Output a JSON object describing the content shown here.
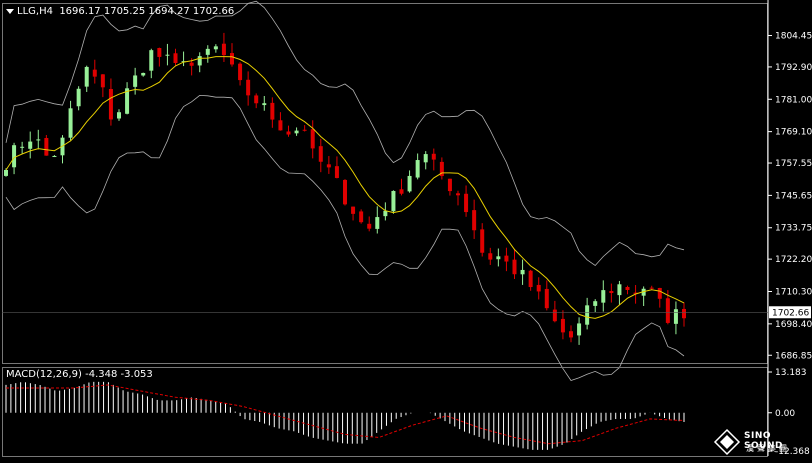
{
  "header": {
    "symbol": "LLG,H4",
    "ohlc": "1696.17 1705.25 1694.27 1702.66"
  },
  "macd_panel": {
    "label": "MACD(12,26,9) -4.348 -3.053",
    "ticks": [
      "13.183",
      "0.00",
      "-12.368"
    ],
    "tick_values": [
      13.183,
      0.0,
      -12.368
    ]
  },
  "price_axis": {
    "ticks": [
      "1804.45",
      "1792.90",
      "1781.00",
      "1769.10",
      "1757.55",
      "1745.65",
      "1733.75",
      "1722.20",
      "1710.30",
      "1698.40",
      "1686.85"
    ],
    "tick_values": [
      1804.45,
      1792.9,
      1781.0,
      1769.1,
      1757.55,
      1745.65,
      1733.75,
      1722.2,
      1710.3,
      1698.4,
      1686.85
    ],
    "current_price": "1702.66"
  },
  "logo": {
    "text": "SINO SOUND",
    "chinese": "漢聲集團"
  },
  "colors": {
    "background": "#000000",
    "bull": "#98f098",
    "bear": "#e00000",
    "ma": "#e8d000",
    "bands": "#b0b0b0",
    "macd_hist": "#ffffff",
    "macd_signal": "#e00000",
    "axis": "#ffffff"
  },
  "chart_data": {
    "type": "candlestick",
    "ylim": [
      1684,
      1812
    ],
    "close_path": [
      [
        0,
        1758
      ],
      [
        8,
        1764
      ],
      [
        16,
        1768
      ],
      [
        24,
        1760
      ],
      [
        32,
        1762
      ],
      [
        40,
        1780
      ],
      [
        48,
        1792
      ],
      [
        56,
        1786
      ],
      [
        64,
        1772
      ],
      [
        70,
        1782
      ],
      [
        78,
        1790
      ],
      [
        86,
        1798
      ],
      [
        94,
        1796
      ],
      [
        100,
        1792
      ],
      [
        106,
        1798
      ],
      [
        112,
        1791
      ],
      [
        118,
        1798
      ],
      [
        126,
        1800
      ],
      [
        132,
        1794
      ],
      [
        138,
        1786
      ],
      [
        146,
        1782
      ],
      [
        154,
        1777
      ],
      [
        162,
        1772
      ],
      [
        170,
        1768
      ],
      [
        176,
        1773
      ],
      [
        182,
        1760
      ],
      [
        190,
        1756
      ],
      [
        198,
        1748
      ],
      [
        206,
        1740
      ],
      [
        214,
        1732
      ],
      [
        222,
        1740
      ],
      [
        230,
        1745
      ],
      [
        238,
        1752
      ],
      [
        246,
        1762
      ],
      [
        254,
        1756
      ],
      [
        262,
        1750
      ],
      [
        270,
        1745
      ],
      [
        278,
        1733
      ],
      [
        284,
        1722
      ],
      [
        290,
        1724
      ],
      [
        298,
        1720
      ],
      [
        306,
        1716
      ],
      [
        314,
        1710
      ],
      [
        322,
        1702
      ],
      [
        328,
        1696
      ],
      [
        336,
        1693
      ],
      [
        342,
        1700
      ],
      [
        350,
        1708
      ],
      [
        358,
        1711
      ],
      [
        366,
        1713
      ],
      [
        372,
        1710
      ],
      [
        378,
        1712
      ],
      [
        384,
        1709
      ],
      [
        392,
        1701
      ],
      [
        398,
        1702
      ],
      [
        402,
        1703
      ]
    ],
    "macd_path": [
      [
        0,
        9
      ],
      [
        10,
        10
      ],
      [
        20,
        9
      ],
      [
        30,
        7
      ],
      [
        40,
        8
      ],
      [
        50,
        10
      ],
      [
        60,
        10
      ],
      [
        70,
        7
      ],
      [
        80,
        6
      ],
      [
        90,
        4
      ],
      [
        100,
        4
      ],
      [
        110,
        5
      ],
      [
        120,
        4
      ],
      [
        130,
        3
      ],
      [
        140,
        -2
      ],
      [
        150,
        -3
      ],
      [
        160,
        -5
      ],
      [
        170,
        -6
      ],
      [
        180,
        -8
      ],
      [
        190,
        -9
      ],
      [
        200,
        -10
      ],
      [
        210,
        -10
      ],
      [
        220,
        -6
      ],
      [
        230,
        -2
      ],
      [
        240,
        0
      ],
      [
        250,
        0
      ],
      [
        260,
        -3
      ],
      [
        270,
        -6
      ],
      [
        280,
        -8
      ],
      [
        290,
        -10
      ],
      [
        300,
        -11
      ],
      [
        310,
        -12
      ],
      [
        320,
        -12
      ],
      [
        330,
        -10
      ],
      [
        340,
        -6
      ],
      [
        350,
        -3
      ],
      [
        360,
        -2
      ],
      [
        370,
        -2
      ],
      [
        380,
        0
      ],
      [
        390,
        -2
      ],
      [
        400,
        -3
      ]
    ],
    "signal_path": [
      [
        0,
        8
      ],
      [
        20,
        8
      ],
      [
        40,
        8
      ],
      [
        60,
        9
      ],
      [
        80,
        7
      ],
      [
        100,
        5
      ],
      [
        120,
        4
      ],
      [
        140,
        2
      ],
      [
        160,
        -1
      ],
      [
        180,
        -4
      ],
      [
        200,
        -7
      ],
      [
        220,
        -8
      ],
      [
        240,
        -4
      ],
      [
        260,
        -1
      ],
      [
        280,
        -5
      ],
      [
        300,
        -8
      ],
      [
        320,
        -10
      ],
      [
        340,
        -9
      ],
      [
        360,
        -5
      ],
      [
        380,
        -2
      ],
      [
        400,
        -2.5
      ]
    ]
  }
}
